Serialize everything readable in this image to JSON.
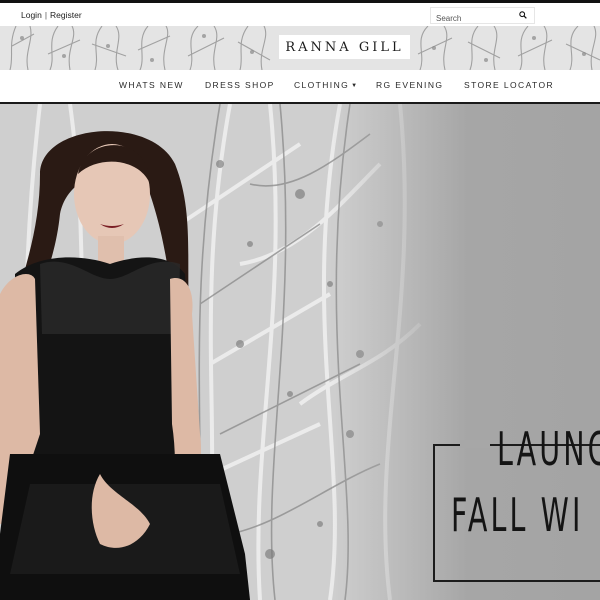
{
  "utility_bar": {
    "login_label": "Login",
    "separator": "|",
    "register_label": "Register",
    "search_placeholder": "Search",
    "search_icon": "search-icon"
  },
  "brand": {
    "logo_text": "RANNA GILL"
  },
  "nav": {
    "items": [
      {
        "label": "WHATS NEW"
      },
      {
        "label": "DRESS SHOP"
      },
      {
        "label": "CLOTHING",
        "has_dropdown": true
      },
      {
        "label": "RG EVENING"
      },
      {
        "label": "STORE LOCATOR"
      }
    ]
  },
  "hero": {
    "headline_line1": "LAUNC",
    "headline_line2": "FALL WI"
  },
  "colors": {
    "text_dark": "#141414",
    "hero_gray": "#9e9e9e",
    "nav_border": "#1a1a1a"
  }
}
